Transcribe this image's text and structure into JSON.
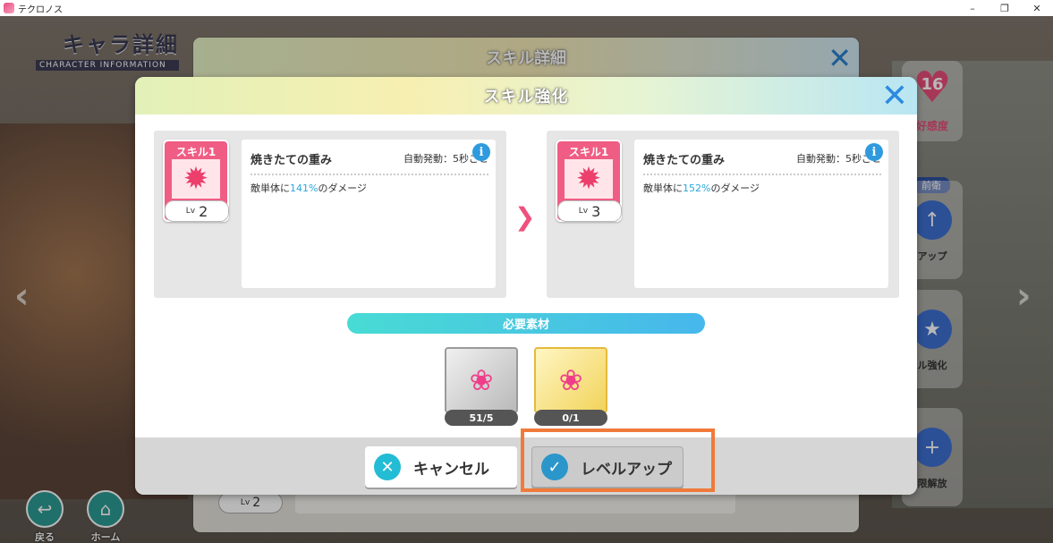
{
  "window": {
    "title": "テクロノス",
    "minimize": "–",
    "restore": "❐",
    "close": "✕"
  },
  "background": {
    "char_title_jp": "キャラ詳細",
    "char_title_en": "CHARACTER INFORMATION",
    "affection_value": "16",
    "affection_label": "好感度",
    "side_tag": "前衛",
    "side_btn1_label": "アップ",
    "side_btn2_label": "ル強化",
    "side_btn3_label": "限解放",
    "back_label": "戻る",
    "home_label": "ホーム"
  },
  "back_dialog": {
    "title": "スキル詳細",
    "lv_prefix": "Lv",
    "lv_value": "2"
  },
  "dialog": {
    "title": "スキル強化",
    "current": {
      "badge_label": "スキル1",
      "lv_prefix": "Lv",
      "lv_value": "2",
      "skill_name": "焼きたての重み",
      "trigger": "自動発動：5秒ごと",
      "desc_prefix": "敵単体に",
      "desc_pct": "141%",
      "desc_suffix": "のダメージ"
    },
    "next": {
      "badge_label": "スキル1",
      "lv_prefix": "Lv",
      "lv_value": "3",
      "skill_name": "焼きたての重み",
      "trigger": "自動発動：5秒ごと",
      "desc_prefix": "敵単体に",
      "desc_pct": "152%",
      "desc_suffix": "のダメージ"
    },
    "materials_label": "必要素材",
    "materials": [
      {
        "icon": "candy-icon",
        "count": "51/5",
        "rarity": "silver"
      },
      {
        "icon": "candy-icon",
        "count": "0/1",
        "rarity": "gold"
      }
    ],
    "cancel_label": "キャンセル",
    "levelup_label": "レベルアップ"
  },
  "colors": {
    "accent_pink": "#f05d84",
    "accent_blue": "#2d8ae0",
    "highlight": "#f07a3a"
  }
}
